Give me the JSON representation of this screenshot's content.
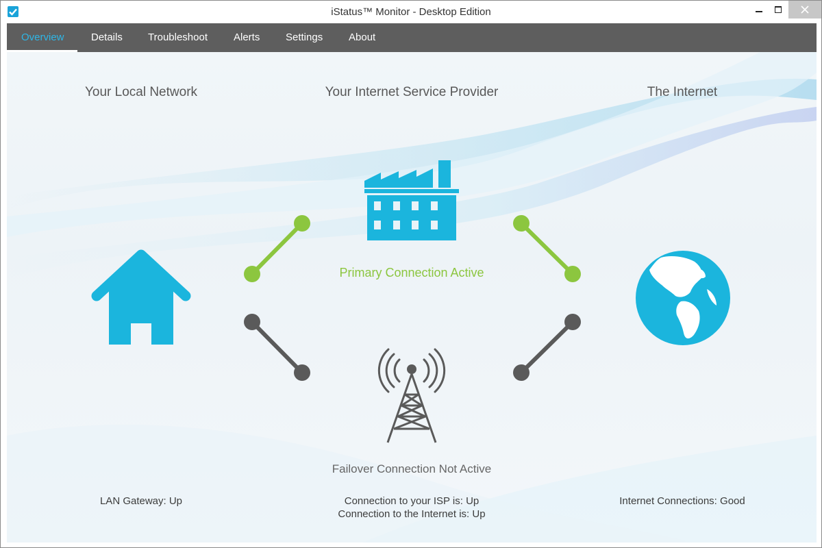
{
  "window": {
    "title": "iStatus™ Monitor - Desktop Edition"
  },
  "nav": {
    "tabs": [
      {
        "label": "Overview",
        "active": true
      },
      {
        "label": "Details",
        "active": false
      },
      {
        "label": "Troubleshoot",
        "active": false
      },
      {
        "label": "Alerts",
        "active": false
      },
      {
        "label": "Settings",
        "active": false
      },
      {
        "label": "About",
        "active": false
      }
    ]
  },
  "overview": {
    "columns": {
      "local": {
        "heading": "Your Local Network",
        "status": "LAN Gateway: Up",
        "icon": "house-icon"
      },
      "isp": {
        "heading": "Your Internet Service Provider",
        "status_line1": "Connection to your ISP is: Up",
        "status_line2": "Connection to the Internet is: Up",
        "icon": "factory-icon"
      },
      "internet": {
        "heading": "The Internet",
        "status": "Internet Connections: Good",
        "icon": "globe-icon"
      }
    },
    "primary": {
      "label": "Primary Connection Active",
      "icon": "factory-icon"
    },
    "failover": {
      "label": "Failover Connection Not Active",
      "icon": "cell-tower-icon"
    }
  },
  "colors": {
    "accent": "#1bb5dd",
    "active_link": "#8cc63f",
    "inactive_link": "#5a5a5a",
    "nav_bg": "#5e5e5e",
    "nav_active": "#2eb6e6"
  }
}
